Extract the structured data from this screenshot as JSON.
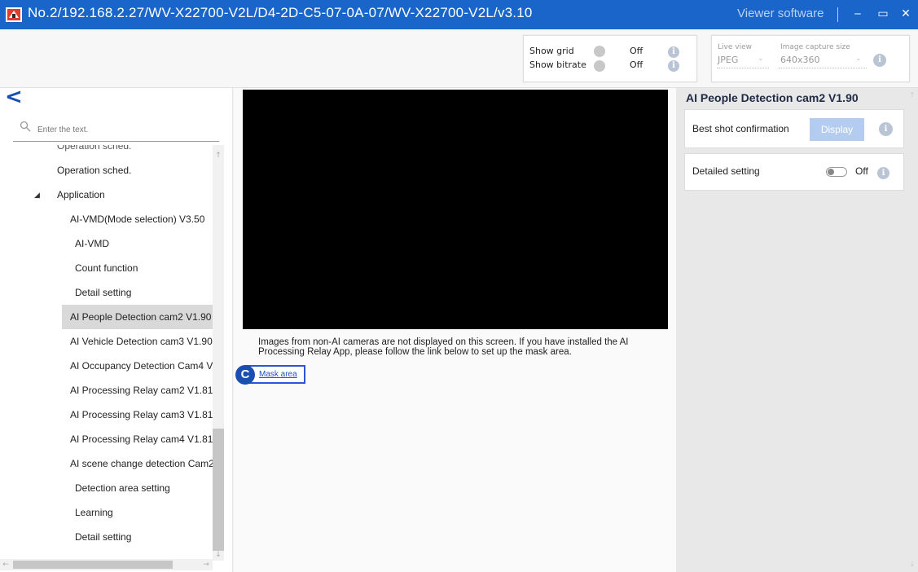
{
  "window": {
    "title": "No.2/192.168.2.27/WV-X22700-V2L/D4-2D-C5-07-0A-07/WV-X22700-V2L/v3.10",
    "brand": "Viewer software",
    "minimize_glyph": "‒",
    "maximize_glyph": "▭",
    "close_glyph": "✕"
  },
  "toolbar": {
    "show_grid_label": "Show grid",
    "show_grid_state": "Off",
    "show_bitrate_label": "Show bitrate",
    "show_bitrate_state": "Off",
    "live_view_label": "Live view",
    "live_view_value": "JPEG",
    "capture_size_label": "Image capture size",
    "capture_size_value": "640x360",
    "info_glyph": "i"
  },
  "sidebar": {
    "back_glyph": "<",
    "search_placeholder": "Enter the text.",
    "items": [
      {
        "label": "Operation sched.",
        "level": 2
      },
      {
        "label": "Operation sched.",
        "level": 2
      },
      {
        "label": "Application",
        "level": 1,
        "expanded": true
      },
      {
        "label": "AI-VMD(Mode selection) V3.50",
        "level": 2
      },
      {
        "label": "AI-VMD",
        "level": 3
      },
      {
        "label": "Count function",
        "level": 3
      },
      {
        "label": "Detail setting",
        "level": 3
      },
      {
        "label": "AI People Detection cam2 V1.90",
        "level": 2,
        "selected": true
      },
      {
        "label": "AI Vehicle Detection cam3 V1.90",
        "level": 2
      },
      {
        "label": "AI Occupancy Detection Cam4 V",
        "level": 2
      },
      {
        "label": "AI Processing Relay cam2 V1.81",
        "level": 2
      },
      {
        "label": "AI Processing Relay cam3 V1.81",
        "level": 2
      },
      {
        "label": "AI Processing Relay cam4 V1.81",
        "level": 2
      },
      {
        "label": "AI scene change detection Cam2",
        "level": 2
      },
      {
        "label": "Detection area setting",
        "level": 3
      },
      {
        "label": "Learning",
        "level": 3
      },
      {
        "label": "Detail setting",
        "level": 3
      }
    ],
    "expander_glyph": "◢"
  },
  "main": {
    "notice": "Images from non-AI cameras are not displayed on this screen. If you have installed the AI Processing Relay App, please follow the link below to set up the mask area.",
    "callout_letter": "C",
    "mask_link_label": "Mask area"
  },
  "right_panel": {
    "heading": "AI People Detection cam2 V1.90",
    "best_shot_label": "Best shot confirmation",
    "display_button": "Display",
    "detailed_setting_label": "Detailed setting",
    "detailed_setting_state": "Off"
  },
  "colors": {
    "title_bar": "#1a65c9",
    "accent": "#1a4fb0",
    "display_button": "#b3ccef",
    "selected_item": "#d9d9d9"
  }
}
